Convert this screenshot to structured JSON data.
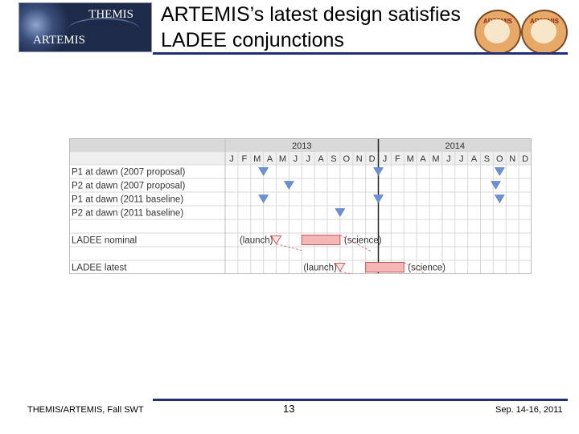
{
  "header": {
    "logo_line1": "THEMIS",
    "logo_line2": "ARTEMIS",
    "title_line1": "ARTEMIS’s latest design satisfies",
    "title_line2": "LADEE conjunctions",
    "badge_text": "ARTEMIS"
  },
  "chart_data": {
    "type": "table",
    "years": [
      "2013",
      "2014"
    ],
    "months": [
      "J",
      "F",
      "M",
      "A",
      "M",
      "J",
      "J",
      "A",
      "S",
      "O",
      "N",
      "D",
      "J",
      "F",
      "M",
      "A",
      "M",
      "J",
      "J",
      "A",
      "S",
      "O",
      "N",
      "D"
    ],
    "rows": [
      {
        "label": "P1 at dawn (2007 proposal)",
        "markers": [
          3,
          12,
          21.5
        ]
      },
      {
        "label": "P2 at dawn (2007 proposal)",
        "markers": [
          5,
          21.2
        ]
      },
      {
        "label": "P1 at dawn (2011 baseline)",
        "markers": [
          3,
          12,
          21.5
        ]
      },
      {
        "label": "P2 at dawn (2011 baseline)",
        "markers": [
          9
        ]
      },
      {
        "label": "",
        "markers": []
      },
      {
        "label": "LADEE nominal",
        "launch_label": "(launch)",
        "launch_month": 4,
        "bar": [
          6,
          9
        ],
        "science_label": "(science)"
      },
      {
        "label": "",
        "markers": []
      },
      {
        "label": "LADEE latest",
        "launch_label": "(launch)",
        "launch_month": 9,
        "bar": [
          11,
          14
        ],
        "science_label": "(science)"
      }
    ]
  },
  "footer": {
    "left": "THEMIS/ARTEMIS, Fall SWT",
    "page": "13",
    "right": "Sep. 14-16, 2011"
  },
  "colors": {
    "triangle_blue": "#6d8fd6",
    "ladee_fill": "#f4b6b6",
    "ladee_stroke": "#d05a5a",
    "header_gray": "#d9d9d9",
    "rule": "#1f2d7a"
  }
}
